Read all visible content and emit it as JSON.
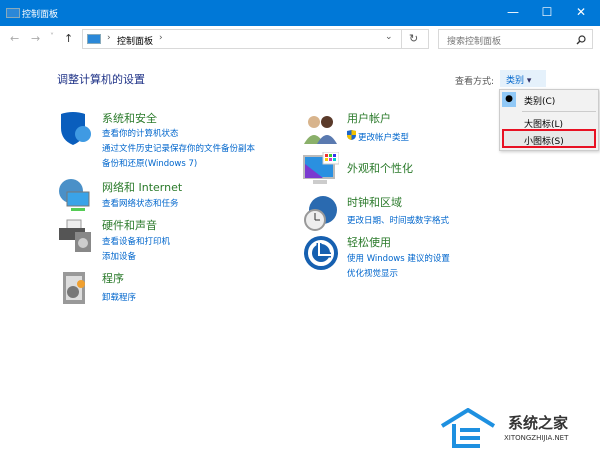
{
  "window": {
    "title": "控制面板",
    "minimize": "—",
    "maximize": "☐",
    "close": "✕"
  },
  "nav": {
    "back": "←",
    "forward": "→",
    "recent": "˅",
    "up": "↑",
    "breadcrumb": "控制面板",
    "sep": "›",
    "dropdown": "⌄",
    "refresh": "↻"
  },
  "search": {
    "placeholder": "搜索控制面板",
    "icon": "search-icon"
  },
  "heading": "调整计算机的设置",
  "view": {
    "label": "查看方式:",
    "value": "类别",
    "arrow": "▾",
    "options": [
      {
        "label": "类别(C)",
        "selected": true
      },
      {
        "label": "大图标(L)"
      },
      {
        "label": "小图标(S)",
        "highlighted": true
      }
    ],
    "highlight_color": "#e81123"
  },
  "left": [
    {
      "title": "系统和安全",
      "links": [
        "查看你的计算机状态",
        "通过文件历史记录保存你的文件备份副本",
        "备份和还原(Windows 7)"
      ]
    },
    {
      "title": "网络和 Internet",
      "links": [
        "查看网络状态和任务"
      ]
    },
    {
      "title": "硬件和声音",
      "links": [
        "查看设备和打印机",
        "添加设备"
      ]
    },
    {
      "title": "程序",
      "links": [
        "卸载程序"
      ]
    }
  ],
  "right": [
    {
      "title": "用户帐户",
      "links": [
        "更改帐户类型"
      ]
    },
    {
      "title": "外观和个性化",
      "links": []
    },
    {
      "title": "时钟和区域",
      "links": [
        "更改日期、时间或数字格式"
      ]
    },
    {
      "title": "轻松使用",
      "links": [
        "使用 Windows 建议的设置",
        "优化视觉显示"
      ]
    }
  ],
  "watermark": {
    "name": "系统之家",
    "url": "XITONGZHIJIA.NET"
  },
  "colors": {
    "titlebar": "#0078d7",
    "link": "#0066cc",
    "category": "#2a7a2a"
  }
}
